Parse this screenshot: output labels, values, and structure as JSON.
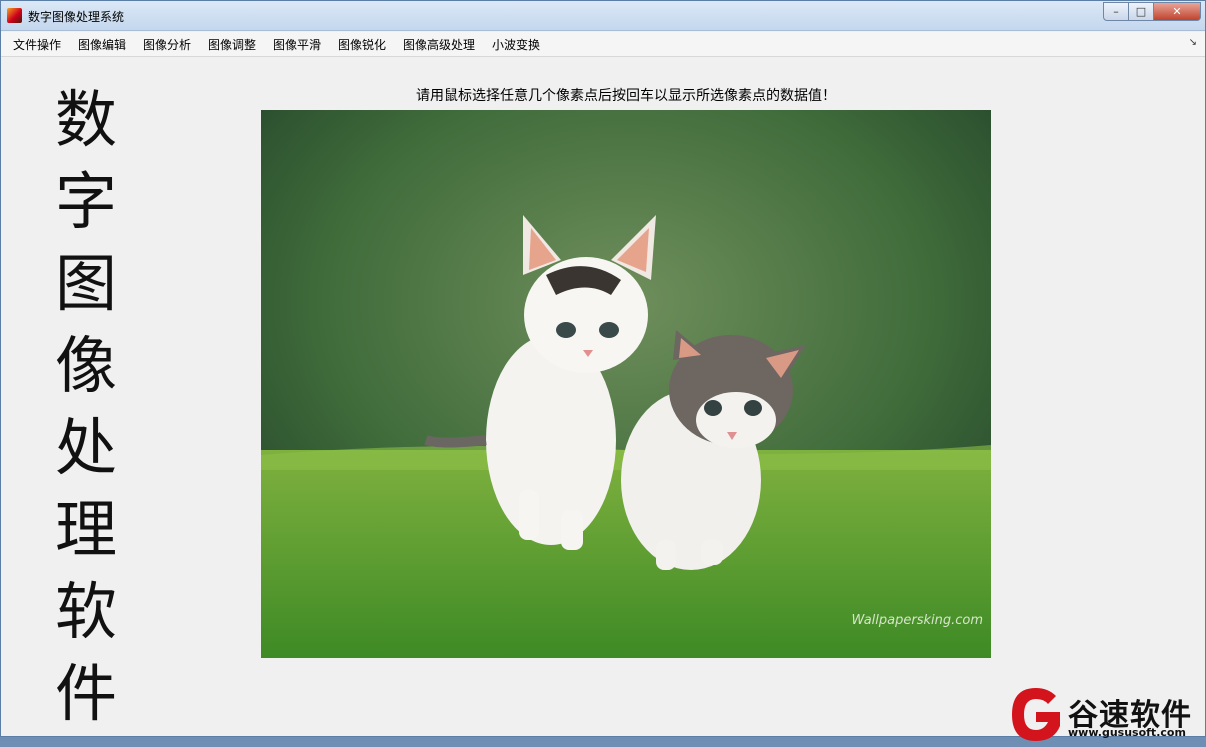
{
  "window": {
    "title": "数字图像处理系统",
    "controls": {
      "minimize": "–",
      "maximize": "□",
      "close": "✕"
    }
  },
  "menu": {
    "items": [
      "文件操作",
      "图像编辑",
      "图像分析",
      "图像调整",
      "图像平滑",
      "图像锐化",
      "图像高级处理",
      "小波变换"
    ],
    "overflow_icon": "arrow-icon"
  },
  "side_title": [
    "数",
    "字",
    "图",
    "像",
    "处",
    "理",
    "软",
    "件"
  ],
  "instruction": "请用鼠标选择任意几个像素点后按回车以显示所选像素点的数据值！",
  "image": {
    "subject": "two-kittens-on-grass",
    "watermark": "Wallpapersking.com"
  },
  "brand": {
    "name": "谷速软件",
    "url": "www.gususoft.com",
    "color": "#d4141c"
  }
}
